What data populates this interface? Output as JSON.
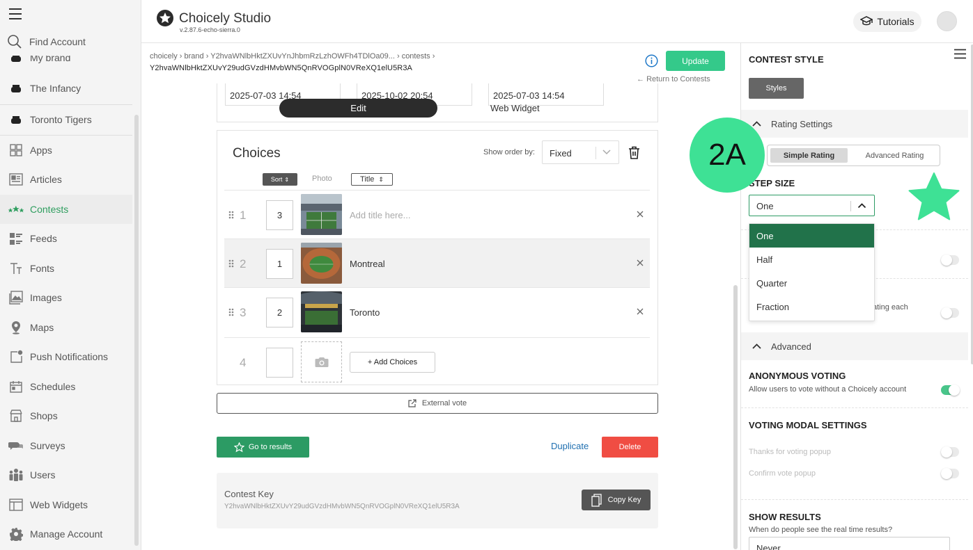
{
  "app": {
    "name": "Choicely Studio",
    "version": "v.2.87.6-echo-sierra.0",
    "tutorials_label": "Tutorials"
  },
  "sidebar": {
    "find_account": "Find Account",
    "partial_item": "My brand",
    "brands": [
      {
        "label": "The Infancy",
        "icon": "bowl-icon"
      },
      {
        "label": "Toronto Tigers",
        "icon": "bowl-icon"
      }
    ],
    "items": [
      {
        "label": "Apps",
        "icon": "grid-icon"
      },
      {
        "label": "Articles",
        "icon": "article-icon"
      },
      {
        "label": "Contests",
        "icon": "contest-icon",
        "active": true
      },
      {
        "label": "Feeds",
        "icon": "feed-icon"
      },
      {
        "label": "Fonts",
        "icon": "font-icon"
      },
      {
        "label": "Images",
        "icon": "image-icon"
      },
      {
        "label": "Maps",
        "icon": "map-pin-icon"
      },
      {
        "label": "Push Notifications",
        "icon": "notification-icon"
      },
      {
        "label": "Schedules",
        "icon": "calendar-icon"
      },
      {
        "label": "Shops",
        "icon": "shop-icon"
      },
      {
        "label": "Surveys",
        "icon": "survey-icon"
      },
      {
        "label": "Users",
        "icon": "users-icon"
      },
      {
        "label": "Web Widgets",
        "icon": "widget-icon"
      },
      {
        "label": "Manage Account",
        "icon": "gear-icon"
      }
    ]
  },
  "breadcrumb": {
    "line1": "choicely › brand › Y2hvaWNlbHktZXUvYnJhbmRzLzhOWFh4TDlOa09... › contests ›",
    "line2": "Y2hvaWNlbHktZXUvY29udGVzdHMvbWN5QnRVOGplN0VReXQ1elU5R3A"
  },
  "actions": {
    "update": "Update",
    "return": "Return to Contests"
  },
  "dates": [
    "2025-07-03 14:54",
    "2025-10-02 20:54",
    "2025-07-03 14:54"
  ],
  "tabs": {
    "edit": "Edit",
    "web_widget": "Web Widget"
  },
  "choices": {
    "title": "Choices",
    "show_order_label": "Show order by:",
    "order_value": "Fixed",
    "sort_label": "Sort",
    "photo_label": "Photo",
    "title_label": "Title",
    "rows": [
      {
        "index": "1",
        "order": "3",
        "title": "Add title here...",
        "placeholder": true
      },
      {
        "index": "2",
        "order": "1",
        "title": "Montreal",
        "placeholder": false
      },
      {
        "index": "3",
        "order": "2",
        "title": "Toronto",
        "placeholder": false
      }
    ],
    "new_row_index": "4",
    "add_label": "+ Add Choices"
  },
  "external_vote": "External vote",
  "go_to_results": "Go to results",
  "duplicate": "Duplicate",
  "delete": "Delete",
  "contest_key": {
    "title": "Contest Key",
    "value": "Y2hvaWNlbHktZXUvY29udGVzdHMvbWN5QnRVOGplN0VReXQ1elU5R3A",
    "copy_label": "Copy Key"
  },
  "panel": {
    "title": "CONTEST STYLE",
    "styles_button": "Styles",
    "rating_settings": "Rating Settings",
    "simple_rating": "Simple Rating",
    "advanced_rating": "Advanced Rating",
    "step_size_label": "STEP SIZE",
    "step_value": "One",
    "step_options": [
      "One",
      "Half",
      "Quarter",
      "Fraction"
    ],
    "partial_text": "ating each",
    "advanced": "Advanced",
    "anonymous_title": "ANONYMOUS VOTING",
    "anonymous_desc": "Allow users to vote without a Choicely account",
    "modal_title": "VOTING MODAL SETTINGS",
    "thanks_popup": "Thanks for voting popup",
    "confirm_popup": "Confirm vote popup",
    "show_results_title": "SHOW RESULTS",
    "show_results_desc": "When do people see the real time results?",
    "show_results_value": "Never"
  },
  "annotation": {
    "badge": "2A",
    "color": "#3ee195"
  }
}
